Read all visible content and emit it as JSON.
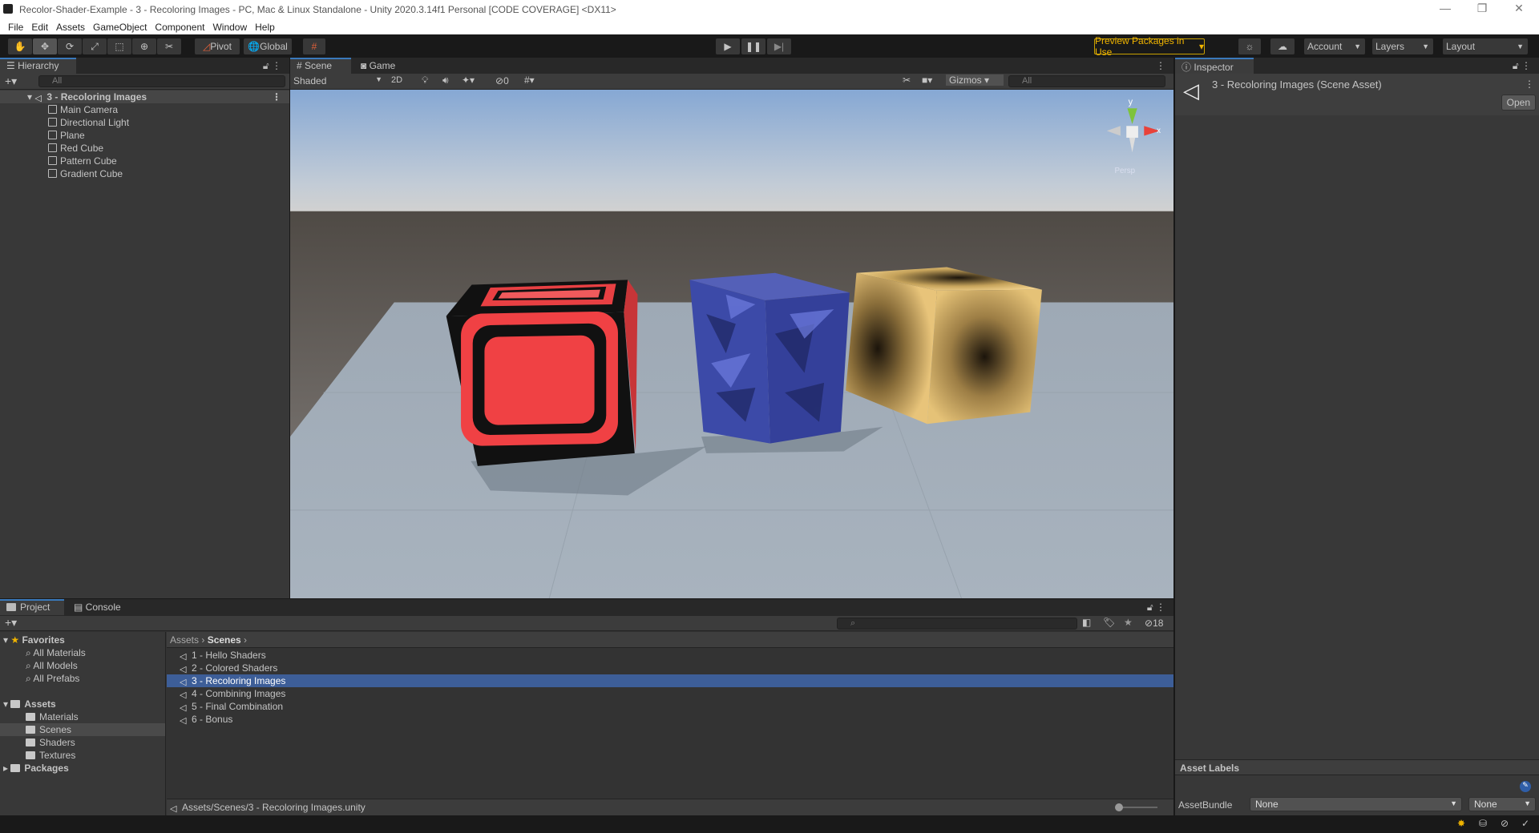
{
  "window": {
    "title": "Recolor-Shader-Example - 3 - Recoloring Images - PC, Mac & Linux Standalone - Unity 2020.3.14f1 Personal [CODE COVERAGE] <DX11>",
    "minimize": "—",
    "maximize": "❐",
    "close": "✕"
  },
  "menu": [
    "File",
    "Edit",
    "Assets",
    "GameObject",
    "Component",
    "Window",
    "Help"
  ],
  "toolbar": {
    "pivot": "Pivot",
    "global": "Global",
    "preview_packages": "Preview Packages in Use",
    "account": "Account",
    "layers": "Layers",
    "layout": "Layout",
    "accent_color": "#f0b400"
  },
  "hierarchy": {
    "tab": "Hierarchy",
    "search_placeholder": "All",
    "scene": "3 - Recoloring Images",
    "items": [
      "Main Camera",
      "Directional Light",
      "Plane",
      "Red Cube",
      "Pattern Cube",
      "Gradient Cube"
    ]
  },
  "scene": {
    "tabs": [
      "Scene",
      "Game"
    ],
    "shading": "Shaded",
    "mode_2d": "2D",
    "hidden_count": "0",
    "gizmos": "Gizmos",
    "search_placeholder": "All",
    "gizmo_axis_y": "y",
    "gizmo_axis_x": "x",
    "view_label": "Persp"
  },
  "inspector": {
    "tab": "Inspector",
    "asset_title": "3 - Recoloring Images (Scene Asset)",
    "open": "Open",
    "asset_labels": "Asset Labels",
    "asset_bundle_label": "AssetBundle",
    "asset_bundle_value": "None",
    "asset_variant_value": "None"
  },
  "project": {
    "tabs": [
      "Project",
      "Console"
    ],
    "hidden_count": "18",
    "favorites": "Favorites",
    "favorite_items": [
      "All Materials",
      "All Models",
      "All Prefabs"
    ],
    "assets": "Assets",
    "asset_folders": [
      "Materials",
      "Scenes",
      "Shaders",
      "Textures"
    ],
    "packages": "Packages",
    "breadcrumb": [
      "Assets",
      "Scenes"
    ],
    "files": [
      "1 - Hello Shaders",
      "2 - Colored Shaders",
      "3 - Recoloring Images",
      "4 - Combining Images",
      "5 - Final Combination",
      "6 - Bonus"
    ],
    "selected_index": 2,
    "path": "Assets/Scenes/3 - Recoloring Images.unity",
    "selection_color": "#3d5e98"
  }
}
